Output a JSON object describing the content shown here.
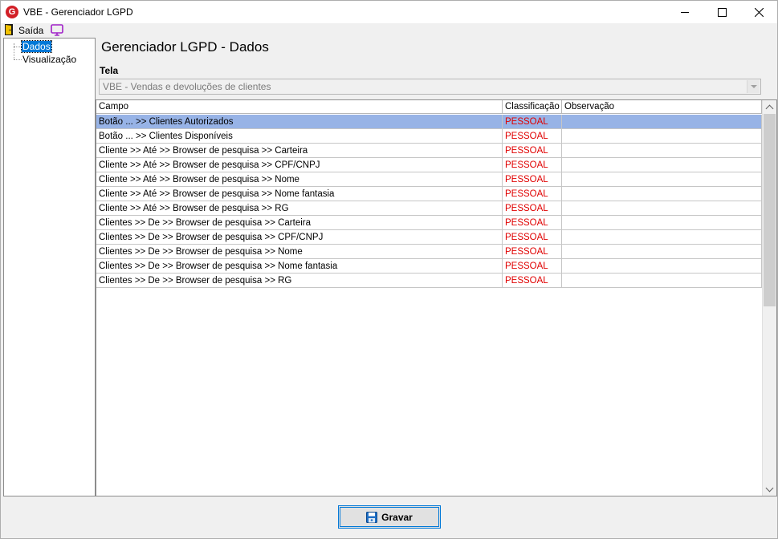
{
  "window": {
    "title": "VBE - Gerenciador LGPD",
    "app_icon_letter": "G"
  },
  "menubar": {
    "exit_label": "Saída"
  },
  "tree": {
    "items": [
      {
        "label": "Dados",
        "selected": true
      },
      {
        "label": "Visualização",
        "selected": false
      }
    ]
  },
  "main": {
    "page_title": "Gerenciador LGPD - Dados",
    "tela_label": "Tela",
    "tela_value": "VBE - Vendas e devoluções de clientes"
  },
  "grid": {
    "columns": [
      "Campo",
      "Classificação",
      "Observação"
    ],
    "rows": [
      {
        "campo": "Botão ... >> Clientes Autorizados",
        "classificacao": "PESSOAL",
        "observacao": "",
        "selected": true
      },
      {
        "campo": "Botão ... >> Clientes Disponíveis",
        "classificacao": "PESSOAL",
        "observacao": ""
      },
      {
        "campo": "Cliente >> Até >> Browser de pesquisa >> Carteira",
        "classificacao": "PESSOAL",
        "observacao": ""
      },
      {
        "campo": "Cliente >> Até >> Browser de pesquisa >> CPF/CNPJ",
        "classificacao": "PESSOAL",
        "observacao": ""
      },
      {
        "campo": "Cliente >> Até >> Browser de pesquisa >> Nome",
        "classificacao": "PESSOAL",
        "observacao": ""
      },
      {
        "campo": "Cliente >> Até >> Browser de pesquisa >> Nome fantasia",
        "classificacao": "PESSOAL",
        "observacao": ""
      },
      {
        "campo": "Cliente >> Até >> Browser de pesquisa >> RG",
        "classificacao": "PESSOAL",
        "observacao": ""
      },
      {
        "campo": "Clientes >> De >> Browser de pesquisa >> Carteira",
        "classificacao": "PESSOAL",
        "observacao": ""
      },
      {
        "campo": "Clientes >> De >> Browser de pesquisa >> CPF/CNPJ",
        "classificacao": "PESSOAL",
        "observacao": ""
      },
      {
        "campo": "Clientes >> De >> Browser de pesquisa >> Nome",
        "classificacao": "PESSOAL",
        "observacao": ""
      },
      {
        "campo": "Clientes >> De >> Browser de pesquisa >> Nome fantasia",
        "classificacao": "PESSOAL",
        "observacao": ""
      },
      {
        "campo": "Clientes >> De >> Browser de pesquisa >> RG",
        "classificacao": "PESSOAL",
        "observacao": ""
      }
    ]
  },
  "footer": {
    "save_label": "Gravar"
  },
  "colors": {
    "selection": "#97b3e6",
    "classification_text": "#e00000",
    "tree_selection": "#0078d7"
  },
  "icons": [
    "app-logo-icon",
    "minimize-icon",
    "maximize-icon",
    "close-icon",
    "exit-door-icon",
    "screen-icon",
    "dropdown-arrow-icon",
    "scroll-up-icon",
    "scroll-down-icon",
    "floppy-disk-icon"
  ]
}
